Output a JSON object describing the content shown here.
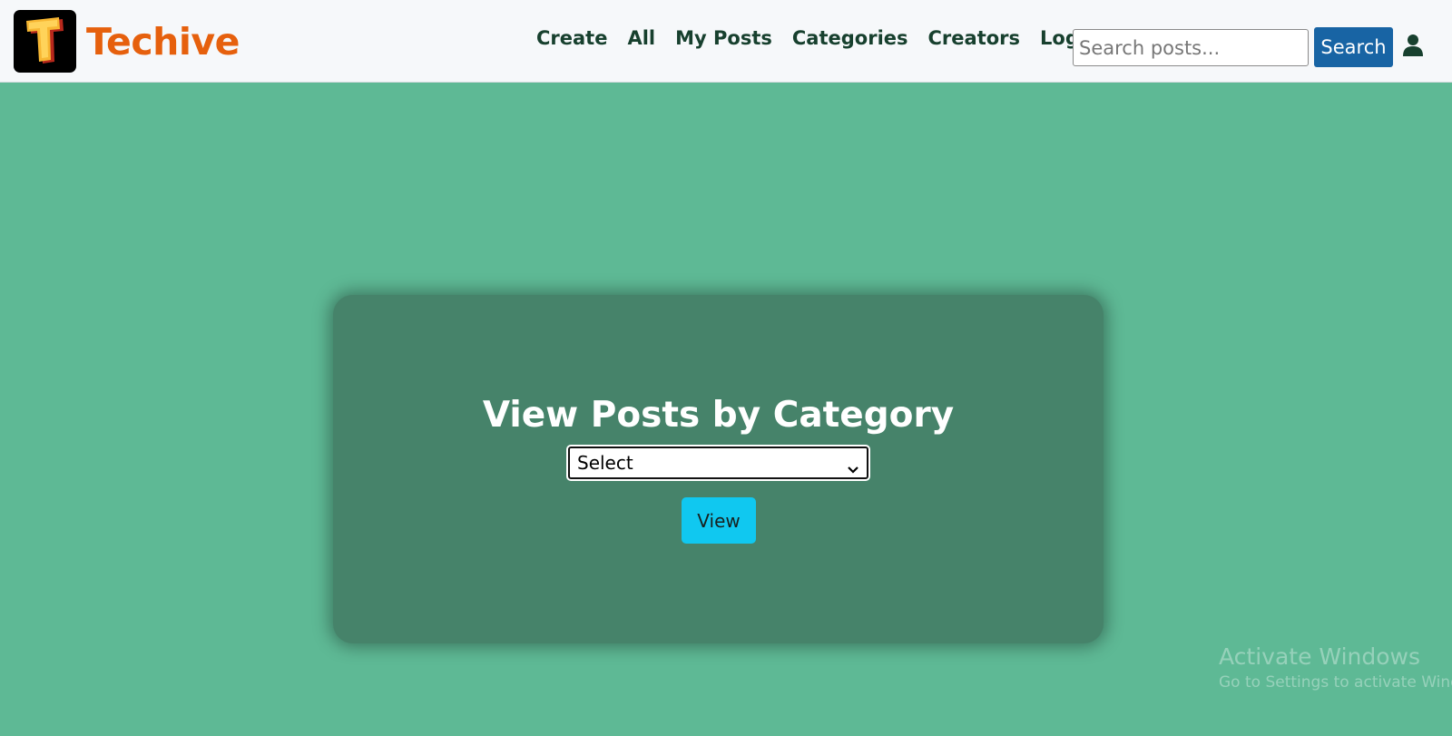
{
  "brand": {
    "name": "Techive",
    "logo_letter": "T",
    "brand_color": "#e6600d"
  },
  "nav": {
    "links": [
      "Create",
      "All",
      "My Posts",
      "Categories",
      "Creators",
      "Logout"
    ],
    "search": {
      "placeholder": "Search posts...",
      "value": "",
      "button_label": "Search"
    },
    "user_icon": "user-icon"
  },
  "main": {
    "title": "View Posts by Category",
    "category_select": {
      "selected": "Select"
    },
    "view_button_label": "View"
  },
  "watermark": {
    "line1": "Activate Windows",
    "line2": "Go to Settings to activate Windows."
  },
  "colors": {
    "background": "#5eb995",
    "card": "#46836a",
    "search_button": "#1864a4",
    "view_button": "#10c8f0"
  }
}
